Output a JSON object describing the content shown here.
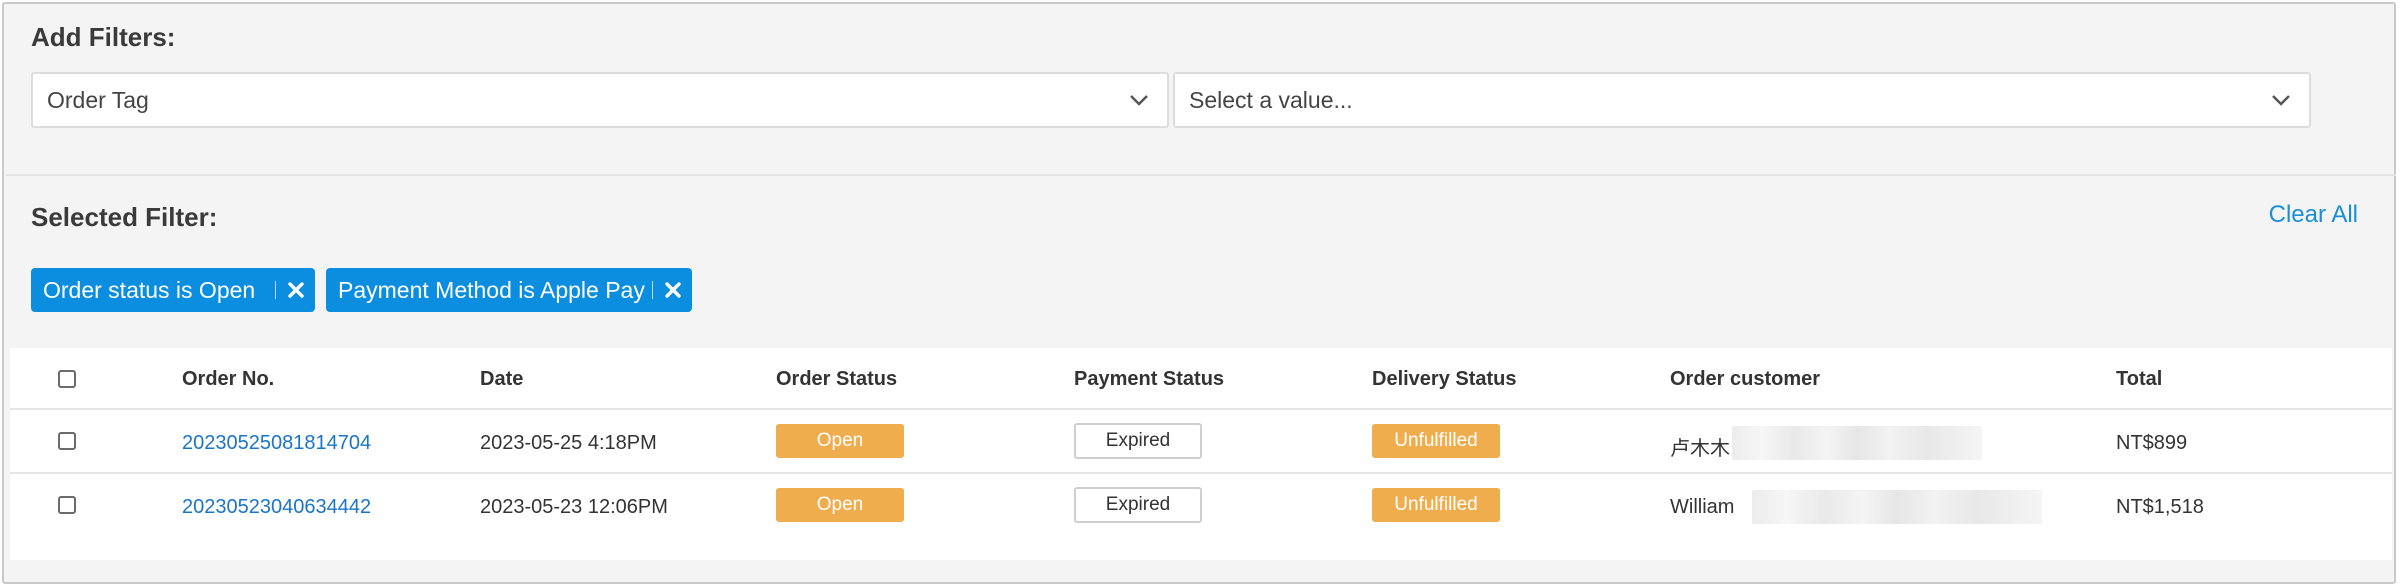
{
  "filters": {
    "title": "Add Filters:",
    "field_select": {
      "value": "Order Tag"
    },
    "value_select": {
      "placeholder": "Select a value..."
    }
  },
  "selected": {
    "title": "Selected Filter:",
    "clear_all": "Clear All",
    "chips": [
      {
        "label": "Order status is Open"
      },
      {
        "label": "Payment Method is Apple Pay"
      }
    ]
  },
  "table": {
    "columns": [
      "Order No.",
      "Date",
      "Order Status",
      "Payment Status",
      "Delivery Status",
      "Order customer",
      "Total"
    ],
    "rows": [
      {
        "order_no": "20230525081814704",
        "date": "2023-05-25 4:18PM",
        "order_status": "Open",
        "payment_status": "Expired",
        "delivery_status": "Unfulfilled",
        "customer": "卢木木",
        "total": "NT$899"
      },
      {
        "order_no": "20230523040634442",
        "date": "2023-05-23 12:06PM",
        "order_status": "Open",
        "payment_status": "Expired",
        "delivery_status": "Unfulfilled",
        "customer": "William",
        "total": "NT$1,518"
      }
    ]
  },
  "colors": {
    "accent": "#0b8ee0",
    "link": "#1a75c7",
    "badge_warning": "#f0ad4e",
    "panel_bg": "#f4f4f4"
  },
  "icons": {
    "dropdown": "chevron-down-icon",
    "remove_chip": "close-icon"
  }
}
